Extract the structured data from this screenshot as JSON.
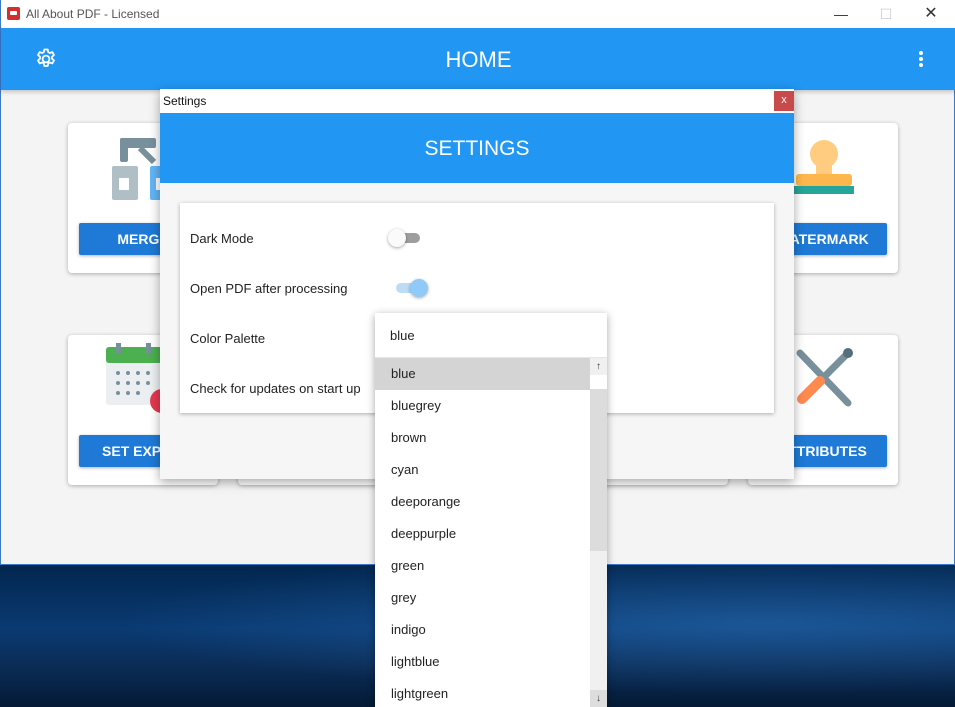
{
  "window": {
    "title": "All About PDF - Licensed",
    "minimize": "—",
    "maximize": "☐",
    "close": "✕"
  },
  "header": {
    "title": "HOME",
    "menu_icon": "kebab-menu-icon",
    "settings_icon": "gear-icon"
  },
  "cards": {
    "merge_label": "MERGE",
    "watermark_label": "WATERMARK",
    "set_expiry_label": "SET EXPIRY",
    "attributes_label": "ATTRIBUTES"
  },
  "settings": {
    "window_title": "Settings",
    "close": "x",
    "header_title": "SETTINGS",
    "dark_mode": {
      "label": "Dark Mode",
      "enabled": false
    },
    "open_pdf": {
      "label": "Open PDF after processing",
      "enabled": true
    },
    "color_palette": {
      "label": "Color Palette",
      "value": "blue"
    },
    "check_updates": {
      "label": "Check for updates on start up"
    }
  },
  "dropdown": {
    "selected": "blue",
    "options": [
      "blue",
      "bluegrey",
      "brown",
      "cyan",
      "deeporange",
      "deeppurple",
      "green",
      "grey",
      "indigo",
      "lightblue",
      "lightgreen"
    ],
    "scroll_up": "↑",
    "scroll_down": "↓"
  },
  "colors": {
    "primary": "#2196f3",
    "button": "#1e7ad6",
    "close_red": "#c94a4a"
  }
}
